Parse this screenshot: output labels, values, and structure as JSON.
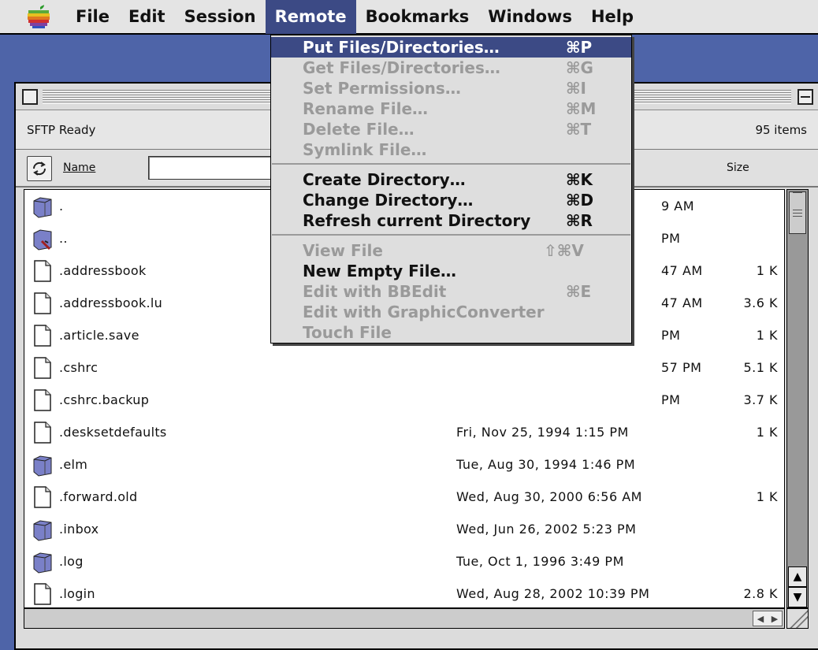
{
  "menubar": {
    "items": [
      "File",
      "Edit",
      "Session",
      "Remote",
      "Bookmarks",
      "Windows",
      "Help"
    ],
    "open_menu": "Remote"
  },
  "remote_menu": {
    "items": [
      {
        "label": "Put Files/Directories…",
        "shortcut": "⌘P",
        "enabled": true,
        "highlighted": true
      },
      {
        "label": "Get Files/Directories…",
        "shortcut": "⌘G",
        "enabled": false
      },
      {
        "label": "Set Permissions…",
        "shortcut": "⌘I",
        "enabled": false
      },
      {
        "label": "Rename File…",
        "shortcut": "⌘M",
        "enabled": false
      },
      {
        "label": "Delete File…",
        "shortcut": "⌘T",
        "enabled": false
      },
      {
        "label": "Symlink File…",
        "shortcut": "",
        "enabled": false
      },
      {
        "label": "Create Directory…",
        "shortcut": "⌘K",
        "enabled": true
      },
      {
        "label": "Change Directory…",
        "shortcut": "⌘D",
        "enabled": true
      },
      {
        "label": "Refresh current Directory",
        "shortcut": "⌘R",
        "enabled": true
      },
      {
        "label": "View File",
        "shortcut": "⇧⌘V",
        "enabled": false
      },
      {
        "label": "New Empty File…",
        "shortcut": "",
        "enabled": true
      },
      {
        "label": "Edit with BBEdit",
        "shortcut": "⌘E",
        "enabled": false
      },
      {
        "label": "Edit with GraphicConverter",
        "shortcut": "",
        "enabled": false
      },
      {
        "label": "Touch File",
        "shortcut": "",
        "enabled": false
      }
    ]
  },
  "window": {
    "status": "SFTP Ready",
    "item_count": "95 items",
    "columns": {
      "name": "Name",
      "size": "Size"
    },
    "filter_value": ""
  },
  "files": [
    {
      "name": ".",
      "date": "9 AM",
      "size": "",
      "kind": "folder"
    },
    {
      "name": "..",
      "date": "PM",
      "size": "",
      "kind": "folder-up"
    },
    {
      "name": ".addressbook",
      "date": "47 AM",
      "size": "1 K",
      "kind": "file"
    },
    {
      "name": ".addressbook.lu",
      "date": "47 AM",
      "size": "3.6 K",
      "kind": "file"
    },
    {
      "name": ".article.save",
      "date": "PM",
      "size": "1 K",
      "kind": "file"
    },
    {
      "name": ".cshrc",
      "date": "57 PM",
      "size": "5.1 K",
      "kind": "file"
    },
    {
      "name": ".cshrc.backup",
      "date": "PM",
      "size": "3.7 K",
      "kind": "file"
    },
    {
      "name": ".desksetdefaults",
      "date": "Fri, Nov 25, 1994 1:15 PM",
      "size": "1 K",
      "kind": "file"
    },
    {
      "name": ".elm",
      "date": "Tue, Aug 30, 1994 1:46 PM",
      "size": "",
      "kind": "folder"
    },
    {
      "name": ".forward.old",
      "date": "Wed, Aug 30, 2000 6:56 AM",
      "size": "1 K",
      "kind": "file"
    },
    {
      "name": ".inbox",
      "date": "Wed, Jun 26, 2002 5:23 PM",
      "size": "",
      "kind": "folder"
    },
    {
      "name": ".log",
      "date": "Tue, Oct 1, 1996 3:49 PM",
      "size": "",
      "kind": "folder"
    },
    {
      "name": ".login",
      "date": "Wed, Aug 28, 2002 10:39 PM",
      "size": "2.8 K",
      "kind": "file"
    }
  ]
}
